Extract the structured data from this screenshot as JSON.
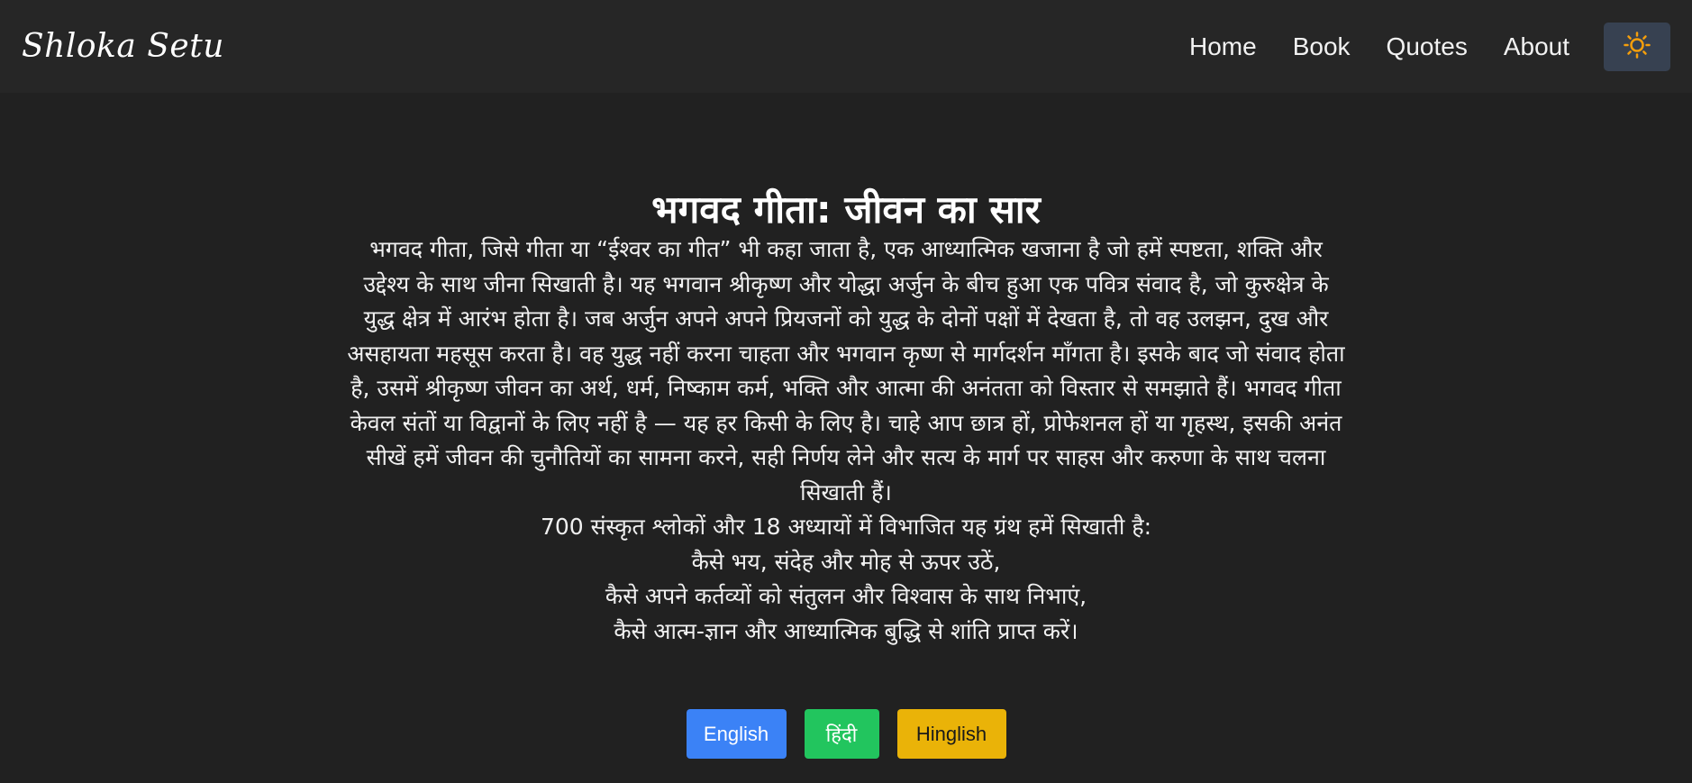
{
  "navbar": {
    "brand": "Shloka Setu",
    "links": [
      "Home",
      "Book",
      "Quotes",
      "About"
    ],
    "theme_toggle_icon": "sun-icon",
    "theme_toggle_color": "#f59e0b"
  },
  "main": {
    "title": "भगवद गीता: जीवन का सार",
    "intro": "भगवद गीता, जिसे गीता या “ईश्वर का गीत” भी कहा जाता है, एक आध्यात्मिक खजाना है जो हमें स्पष्टता, शक्ति और उद्देश्य के साथ जीना सिखाती है। यह भगवान श्रीकृष्ण और योद्धा अर्जुन के बीच हुआ एक पवित्र संवाद है, जो कुरुक्षेत्र के युद्ध क्षेत्र में आरंभ होता है। जब अर्जुन अपने अपने प्रियजनों को युद्ध के दोनों पक्षों में देखता है, तो वह उलझन, दुख और असहायता महसूस करता है। वह युद्ध नहीं करना चाहता और भगवान कृष्ण से मार्गदर्शन माँगता है। इसके बाद जो संवाद होता है, उसमें श्रीकृष्ण जीवन का अर्थ, धर्म, निष्काम कर्म, भक्ति और आत्मा की अनंतता को विस्तार से समझाते हैं। भगवद गीता केवल संतों या विद्वानों के लिए नहीं है — यह हर किसी के लिए है। चाहे आप छात्र हों, प्रोफेशनल हों या गृहस्थ, इसकी अनंत सीखें हमें जीवन की चुनौतियों का सामना करने, सही निर्णय लेने और सत्य के मार्ग पर साहस और करुणा के साथ चलना सिखाती हैं।",
    "lines": [
      "700 संस्कृत श्लोकों और 18 अध्यायों में विभाजित यह ग्रंथ हमें सिखाती है:",
      "कैसे भय, संदेह और मोह से ऊपर उठें,",
      "कैसे अपने कर्तव्यों को संतुलन और विश्वास के साथ निभाएं,",
      "कैसे आत्म-ज्ञान और आध्यात्मिक बुद्धि से शांति प्राप्त करें।"
    ]
  },
  "language_buttons": {
    "english": "English",
    "hindi": "हिंदी",
    "hinglish": "Hinglish",
    "colors": {
      "english": "#3b82f6",
      "hindi": "#22c55e",
      "hinglish": "#eab308"
    }
  }
}
